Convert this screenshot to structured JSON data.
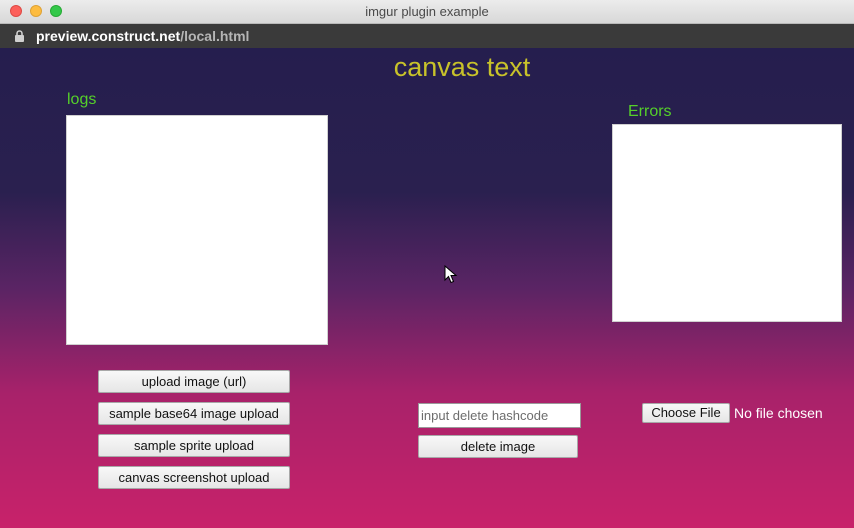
{
  "window": {
    "title": "imgur plugin example"
  },
  "address": {
    "host": "preview.construct.net",
    "path": "/local.html"
  },
  "page": {
    "heading": "canvas text",
    "logs_label": "logs",
    "errors_label": "Errors",
    "buttons": {
      "upload_url": "upload image (url)",
      "base64": "sample base64 image upload",
      "sprite": "sample sprite upload",
      "canvas": "canvas screenshot upload",
      "delete": "delete image",
      "choose_file": "Choose File"
    },
    "delete_input": {
      "placeholder": "input delete hashcode",
      "value": ""
    },
    "file_status": "No file chosen"
  },
  "colors": {
    "heading": "#c8c22a",
    "labels": "#55d02a",
    "background_top": "#251e4e",
    "background_bottom": "#c8226a"
  }
}
